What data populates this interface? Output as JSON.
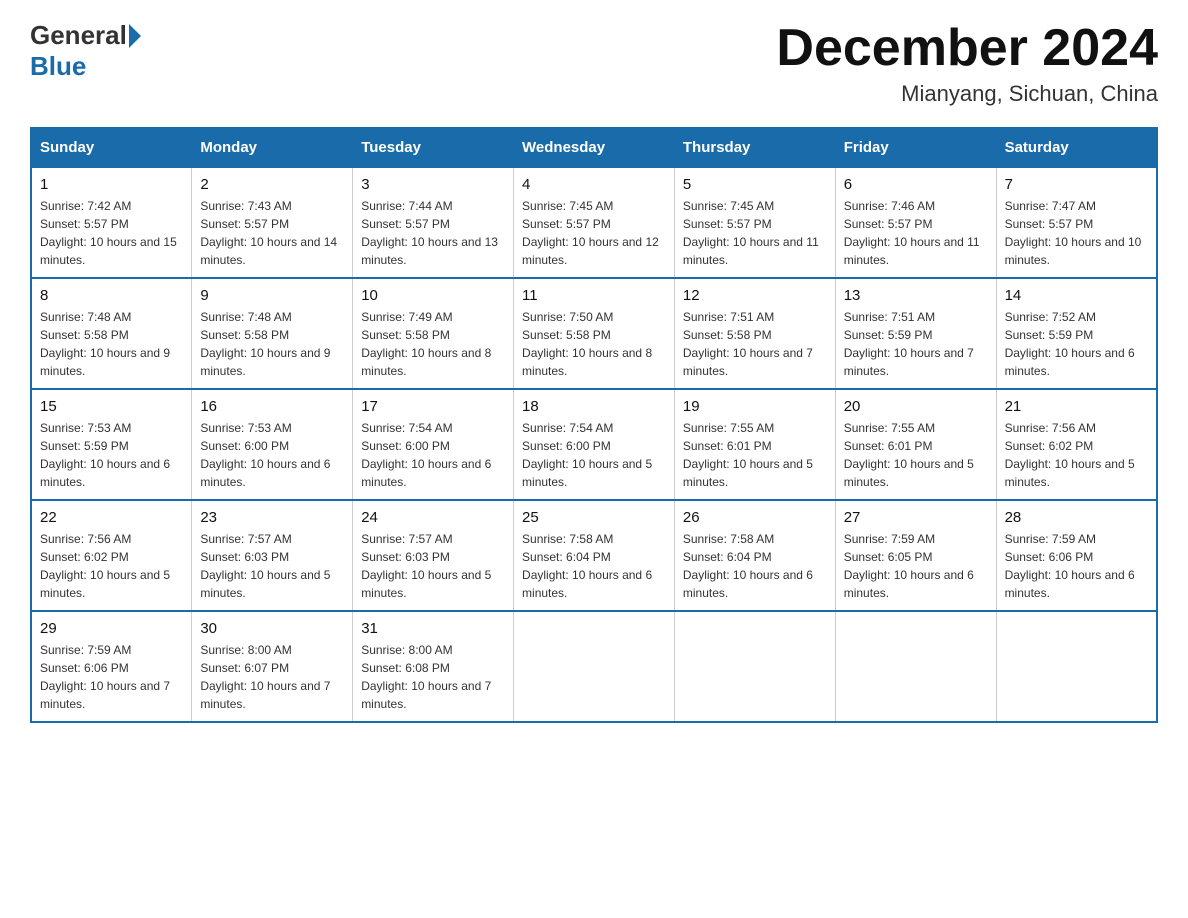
{
  "logo": {
    "text_general": "General",
    "text_blue": "Blue"
  },
  "title": {
    "month_year": "December 2024",
    "location": "Mianyang, Sichuan, China"
  },
  "days_of_week": [
    "Sunday",
    "Monday",
    "Tuesday",
    "Wednesday",
    "Thursday",
    "Friday",
    "Saturday"
  ],
  "weeks": [
    [
      {
        "day": "1",
        "sunrise": "7:42 AM",
        "sunset": "5:57 PM",
        "daylight": "10 hours and 15 minutes."
      },
      {
        "day": "2",
        "sunrise": "7:43 AM",
        "sunset": "5:57 PM",
        "daylight": "10 hours and 14 minutes."
      },
      {
        "day": "3",
        "sunrise": "7:44 AM",
        "sunset": "5:57 PM",
        "daylight": "10 hours and 13 minutes."
      },
      {
        "day": "4",
        "sunrise": "7:45 AM",
        "sunset": "5:57 PM",
        "daylight": "10 hours and 12 minutes."
      },
      {
        "day": "5",
        "sunrise": "7:45 AM",
        "sunset": "5:57 PM",
        "daylight": "10 hours and 11 minutes."
      },
      {
        "day": "6",
        "sunrise": "7:46 AM",
        "sunset": "5:57 PM",
        "daylight": "10 hours and 11 minutes."
      },
      {
        "day": "7",
        "sunrise": "7:47 AM",
        "sunset": "5:57 PM",
        "daylight": "10 hours and 10 minutes."
      }
    ],
    [
      {
        "day": "8",
        "sunrise": "7:48 AM",
        "sunset": "5:58 PM",
        "daylight": "10 hours and 9 minutes."
      },
      {
        "day": "9",
        "sunrise": "7:48 AM",
        "sunset": "5:58 PM",
        "daylight": "10 hours and 9 minutes."
      },
      {
        "day": "10",
        "sunrise": "7:49 AM",
        "sunset": "5:58 PM",
        "daylight": "10 hours and 8 minutes."
      },
      {
        "day": "11",
        "sunrise": "7:50 AM",
        "sunset": "5:58 PM",
        "daylight": "10 hours and 8 minutes."
      },
      {
        "day": "12",
        "sunrise": "7:51 AM",
        "sunset": "5:58 PM",
        "daylight": "10 hours and 7 minutes."
      },
      {
        "day": "13",
        "sunrise": "7:51 AM",
        "sunset": "5:59 PM",
        "daylight": "10 hours and 7 minutes."
      },
      {
        "day": "14",
        "sunrise": "7:52 AM",
        "sunset": "5:59 PM",
        "daylight": "10 hours and 6 minutes."
      }
    ],
    [
      {
        "day": "15",
        "sunrise": "7:53 AM",
        "sunset": "5:59 PM",
        "daylight": "10 hours and 6 minutes."
      },
      {
        "day": "16",
        "sunrise": "7:53 AM",
        "sunset": "6:00 PM",
        "daylight": "10 hours and 6 minutes."
      },
      {
        "day": "17",
        "sunrise": "7:54 AM",
        "sunset": "6:00 PM",
        "daylight": "10 hours and 6 minutes."
      },
      {
        "day": "18",
        "sunrise": "7:54 AM",
        "sunset": "6:00 PM",
        "daylight": "10 hours and 5 minutes."
      },
      {
        "day": "19",
        "sunrise": "7:55 AM",
        "sunset": "6:01 PM",
        "daylight": "10 hours and 5 minutes."
      },
      {
        "day": "20",
        "sunrise": "7:55 AM",
        "sunset": "6:01 PM",
        "daylight": "10 hours and 5 minutes."
      },
      {
        "day": "21",
        "sunrise": "7:56 AM",
        "sunset": "6:02 PM",
        "daylight": "10 hours and 5 minutes."
      }
    ],
    [
      {
        "day": "22",
        "sunrise": "7:56 AM",
        "sunset": "6:02 PM",
        "daylight": "10 hours and 5 minutes."
      },
      {
        "day": "23",
        "sunrise": "7:57 AM",
        "sunset": "6:03 PM",
        "daylight": "10 hours and 5 minutes."
      },
      {
        "day": "24",
        "sunrise": "7:57 AM",
        "sunset": "6:03 PM",
        "daylight": "10 hours and 5 minutes."
      },
      {
        "day": "25",
        "sunrise": "7:58 AM",
        "sunset": "6:04 PM",
        "daylight": "10 hours and 6 minutes."
      },
      {
        "day": "26",
        "sunrise": "7:58 AM",
        "sunset": "6:04 PM",
        "daylight": "10 hours and 6 minutes."
      },
      {
        "day": "27",
        "sunrise": "7:59 AM",
        "sunset": "6:05 PM",
        "daylight": "10 hours and 6 minutes."
      },
      {
        "day": "28",
        "sunrise": "7:59 AM",
        "sunset": "6:06 PM",
        "daylight": "10 hours and 6 minutes."
      }
    ],
    [
      {
        "day": "29",
        "sunrise": "7:59 AM",
        "sunset": "6:06 PM",
        "daylight": "10 hours and 7 minutes."
      },
      {
        "day": "30",
        "sunrise": "8:00 AM",
        "sunset": "6:07 PM",
        "daylight": "10 hours and 7 minutes."
      },
      {
        "day": "31",
        "sunrise": "8:00 AM",
        "sunset": "6:08 PM",
        "daylight": "10 hours and 7 minutes."
      },
      null,
      null,
      null,
      null
    ]
  ],
  "labels": {
    "sunrise": "Sunrise:",
    "sunset": "Sunset:",
    "daylight": "Daylight:"
  }
}
